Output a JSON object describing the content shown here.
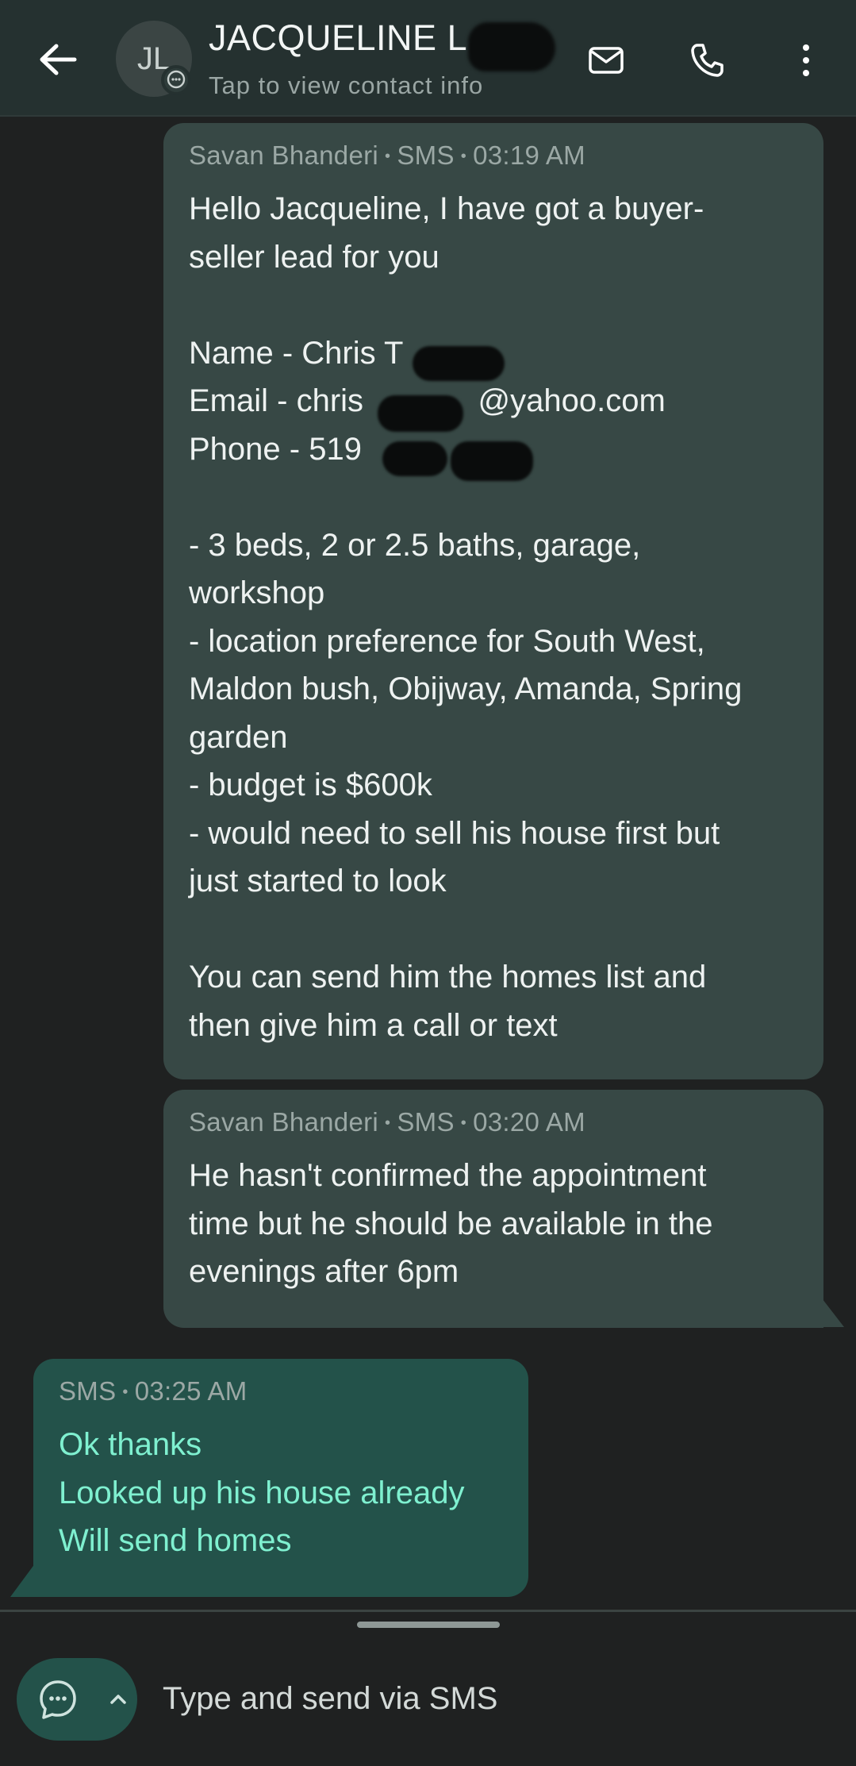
{
  "header": {
    "avatar_initials": "JL",
    "contact_name": "JACQUELINE L",
    "subtitle": "Tap to view contact info"
  },
  "messages": [
    {
      "direction": "outgoing",
      "sender": "Savan Bhanderi",
      "channel": "SMS",
      "time": "03:19 AM",
      "text": "Hello Jacqueline, I have got a buyer-\nseller lead for you\n\nName - Chris T\nEmail - chris             @yahoo.com\nPhone - 519\n\n- 3 beds, 2 or 2.5 baths, garage,\nworkshop\n- location preference for South West,\nMaldon bush, Obijway, Amanda, Spring\ngarden\n- budget is $600k\n- would need to sell his house first but\njust started to look\n\nYou can send him the homes list and\nthen give him a call or text"
    },
    {
      "direction": "outgoing",
      "sender": "Savan Bhanderi",
      "channel": "SMS",
      "time": "03:20 AM",
      "text": "He hasn't confirmed the appointment\ntime but he should be available in the\nevenings after 6pm"
    },
    {
      "direction": "incoming",
      "channel": "SMS",
      "time": "03:25 AM",
      "text": "Ok thanks\nLooked up his house already\nWill send homes"
    }
  ],
  "composer": {
    "placeholder": "Type and send via SMS"
  },
  "colors": {
    "background": "#1f2121",
    "header": "#253130",
    "outgoing_bubble": "#374845",
    "incoming_bubble": "#23524a",
    "incoming_text": "#7ff0d0"
  }
}
